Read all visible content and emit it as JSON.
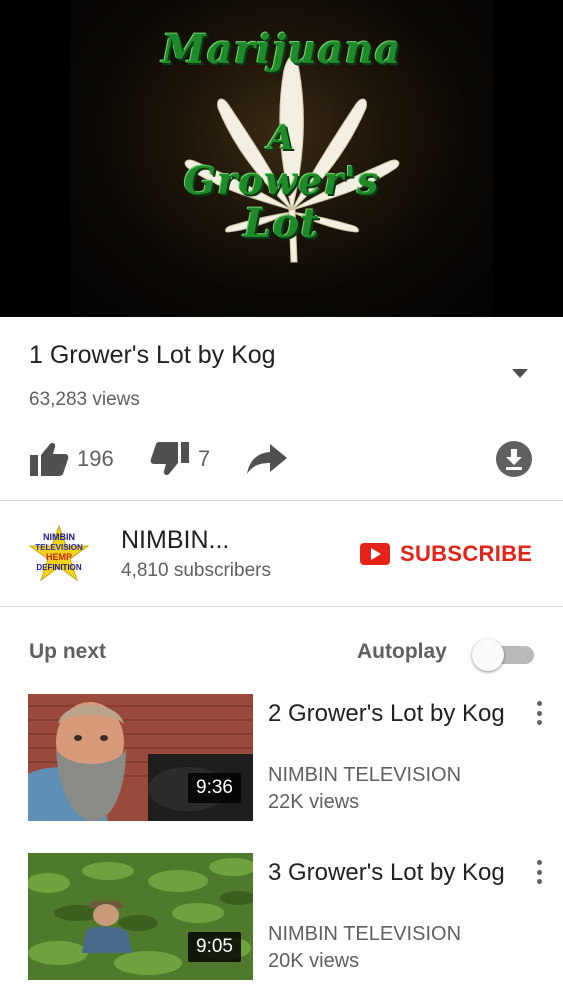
{
  "player": {
    "cover_lines": [
      "Marijuana",
      "A",
      "Grower's",
      "Lot"
    ]
  },
  "video": {
    "title": "1 Grower's Lot by Kog",
    "views": "63,283 views",
    "likes": "196",
    "dislikes": "7"
  },
  "channel": {
    "name": "NIMBIN...",
    "subscribers": "4,810 subscribers",
    "subscribe_label": "SUBSCRIBE",
    "logo_lines": [
      "NIMBIN",
      "TELEVISION",
      "HEMP",
      "DEFINITION"
    ]
  },
  "up_next": {
    "label": "Up next",
    "autoplay_label": "Autoplay",
    "autoplay_on": false,
    "items": [
      {
        "title": "2 Grower's Lot by Kog",
        "channel": "NIMBIN TELEVISION",
        "views": "22K views",
        "duration": "9:36"
      },
      {
        "title": "3 Grower's Lot by Kog",
        "channel": "NIMBIN TELEVISION",
        "views": "20K views",
        "duration": "9:05"
      }
    ]
  },
  "icons": [
    "thumbs-up-icon",
    "thumbs-down-icon",
    "share-icon",
    "download-icon",
    "chevron-down-icon",
    "more-vert-icon"
  ],
  "colors": {
    "accent": "#e62117",
    "text_primary": "#212121",
    "text_secondary": "#606060",
    "divider": "#dcdcdc"
  }
}
